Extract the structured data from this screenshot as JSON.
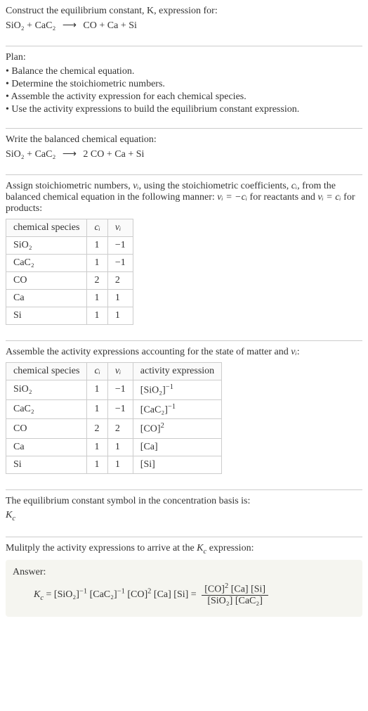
{
  "header": {
    "prompt": "Construct the equilibrium constant, K, expression for:",
    "equation_lhs": "SiO₂ + CaC₂",
    "arrow": "⟶",
    "equation_rhs": "CO + Ca + Si"
  },
  "plan": {
    "title": "Plan:",
    "items": [
      "• Balance the chemical equation.",
      "• Determine the stoichiometric numbers.",
      "• Assemble the activity expression for each chemical species.",
      "• Use the activity expressions to build the equilibrium constant expression."
    ]
  },
  "balanced": {
    "title": "Write the balanced chemical equation:",
    "lhs": "SiO₂ + CaC₂",
    "arrow": "⟶",
    "rhs": "2 CO + Ca + Si"
  },
  "stoich": {
    "title_part1": "Assign stoichiometric numbers, ",
    "title_nu": "νᵢ",
    "title_part2": ", using the stoichiometric coefficients, ",
    "title_c": "cᵢ",
    "title_part3": ", from the balanced chemical equation in the following manner: ",
    "title_eq1": "νᵢ = −cᵢ",
    "title_part4": " for reactants and ",
    "title_eq2": "νᵢ = cᵢ",
    "title_part5": " for products:",
    "headers": [
      "chemical species",
      "cᵢ",
      "νᵢ"
    ],
    "rows": [
      [
        "SiO₂",
        "1",
        "−1"
      ],
      [
        "CaC₂",
        "1",
        "−1"
      ],
      [
        "CO",
        "2",
        "2"
      ],
      [
        "Ca",
        "1",
        "1"
      ],
      [
        "Si",
        "1",
        "1"
      ]
    ]
  },
  "activity": {
    "title_part1": "Assemble the activity expressions accounting for the state of matter and ",
    "title_nu": "νᵢ",
    "title_part2": ":",
    "headers": [
      "chemical species",
      "cᵢ",
      "νᵢ",
      "activity expression"
    ],
    "rows": [
      {
        "species": "SiO₂",
        "c": "1",
        "nu": "−1",
        "expr_base": "[SiO₂]",
        "expr_exp": "−1"
      },
      {
        "species": "CaC₂",
        "c": "1",
        "nu": "−1",
        "expr_base": "[CaC₂]",
        "expr_exp": "−1"
      },
      {
        "species": "CO",
        "c": "2",
        "nu": "2",
        "expr_base": "[CO]",
        "expr_exp": "2"
      },
      {
        "species": "Ca",
        "c": "1",
        "nu": "1",
        "expr_base": "[Ca]",
        "expr_exp": ""
      },
      {
        "species": "Si",
        "c": "1",
        "nu": "1",
        "expr_base": "[Si]",
        "expr_exp": ""
      }
    ]
  },
  "symbol": {
    "title": "The equilibrium constant symbol in the concentration basis is:",
    "symbol_main": "K",
    "symbol_sub": "c"
  },
  "final": {
    "title_part1": "Mulitply the activity expressions to arrive at the ",
    "title_k": "K",
    "title_ksub": "c",
    "title_part2": " expression:",
    "answer_label": "Answer:",
    "kc_main": "K",
    "kc_sub": "c",
    "eq": " = ",
    "term1_base": "[SiO₂]",
    "term1_exp": "−1",
    "term2_base": " [CaC₂]",
    "term2_exp": "−1",
    "term3_base": " [CO]",
    "term3_exp": "2",
    "term4": " [Ca] [Si] = ",
    "frac_num_part1": "[CO]",
    "frac_num_exp": "2",
    "frac_num_part2": " [Ca] [Si]",
    "frac_den": "[SiO₂] [CaC₂]"
  }
}
